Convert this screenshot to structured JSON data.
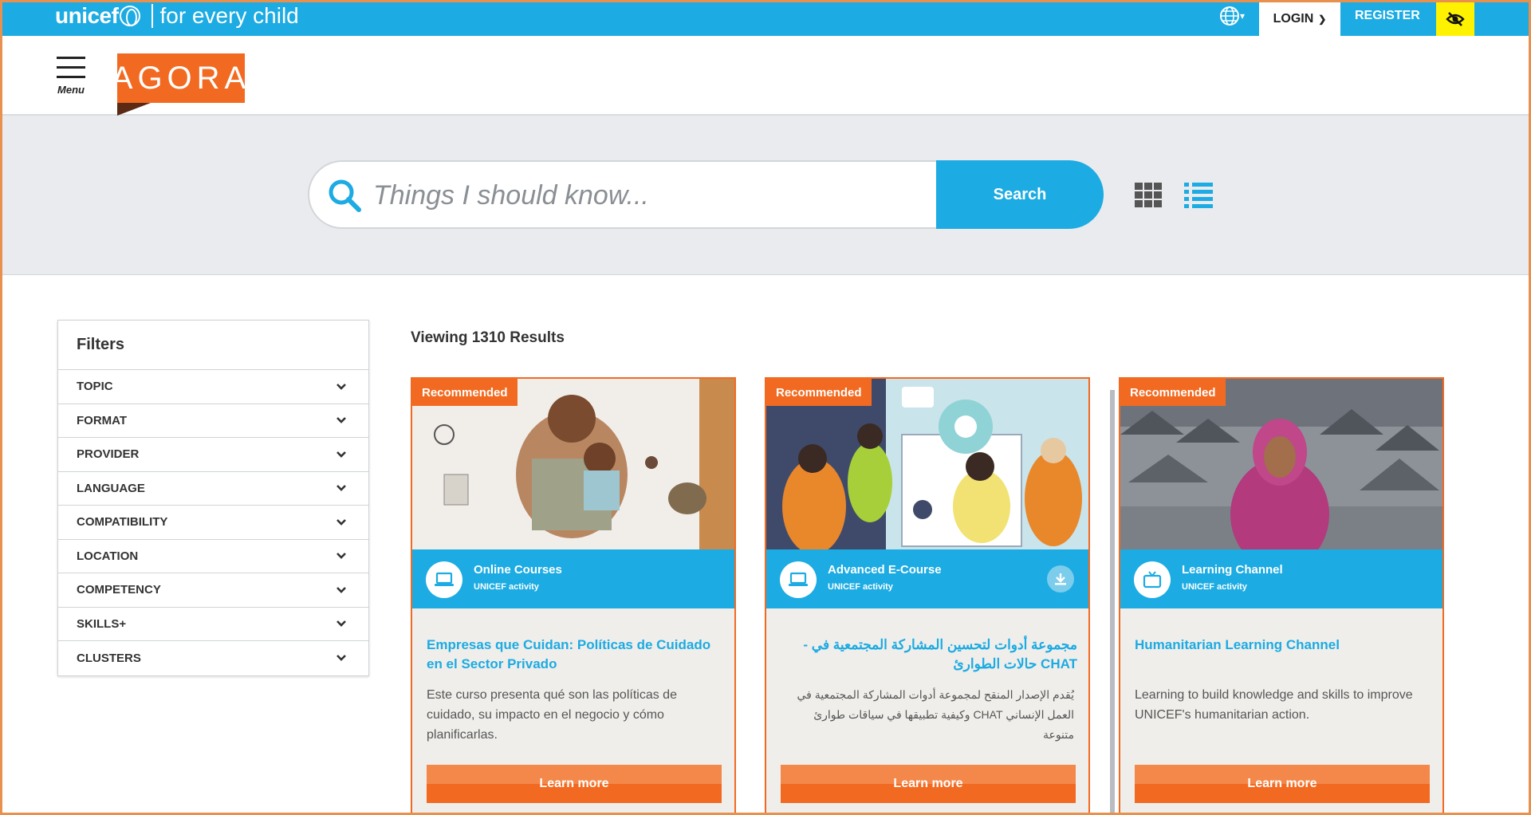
{
  "topbar": {
    "brand_name": "unicef",
    "brand_tagline": "for every child",
    "language_icon": "globe-icon",
    "login_label": "LOGIN",
    "register_label": "REGISTER",
    "accessibility_icon": "eye-slash-icon",
    "bar_color": "#1cabe2",
    "accessibility_color": "#fff200"
  },
  "header": {
    "menu_label": "Menu",
    "logo_text": "AGORA",
    "logo_color": "#f26a21"
  },
  "search": {
    "placeholder": "Things I should know...",
    "value": "",
    "button_label": "Search",
    "view_modes": [
      "grid",
      "list"
    ],
    "active_view": "list"
  },
  "filters": {
    "title": "Filters",
    "items": [
      {
        "label": "TOPIC"
      },
      {
        "label": "FORMAT"
      },
      {
        "label": "PROVIDER"
      },
      {
        "label": "LANGUAGE"
      },
      {
        "label": "COMPATIBILITY"
      },
      {
        "label": "LOCATION"
      },
      {
        "label": "COMPETENCY"
      },
      {
        "label": "SKILLS+"
      },
      {
        "label": "CLUSTERS"
      }
    ]
  },
  "results": {
    "count_label": "Viewing 1310 Results",
    "cards": [
      {
        "badge": "Recommended",
        "type": "Online Courses",
        "subtype": "UNICEF activity",
        "type_icon": "laptop-icon",
        "title": "Empresas que Cuidan: Políticas de Cuidado en el Sector Privado",
        "description": "Este curso presenta qué son las políticas de cuidado, su impacto en el negocio y cómo planificarlas.",
        "button": "Learn more",
        "download": false
      },
      {
        "badge": "Recommended",
        "type": "Advanced E-Course",
        "subtype": "UNICEF activity",
        "type_icon": "laptop-icon",
        "title": "مجموعة أدوات لتحسين المشاركة المجتمعية في - CHAT حالات الطوارئ",
        "description": "يُقدم الإصدار المنقح لمجموعة أدوات المشاركة المجتمعية في العمل الإنساني CHAT وكيفية تطبيقها في سياقات طوارئ متنوعة",
        "button": "Learn more",
        "download": true
      },
      {
        "badge": "Recommended",
        "type": "Learning Channel",
        "subtype": "UNICEF activity",
        "type_icon": "tv-icon",
        "title": "Humanitarian Learning Channel",
        "description": "Learning to build knowledge and skills to improve UNICEF's humanitarian action.",
        "button": "Learn more",
        "download": false
      }
    ]
  }
}
